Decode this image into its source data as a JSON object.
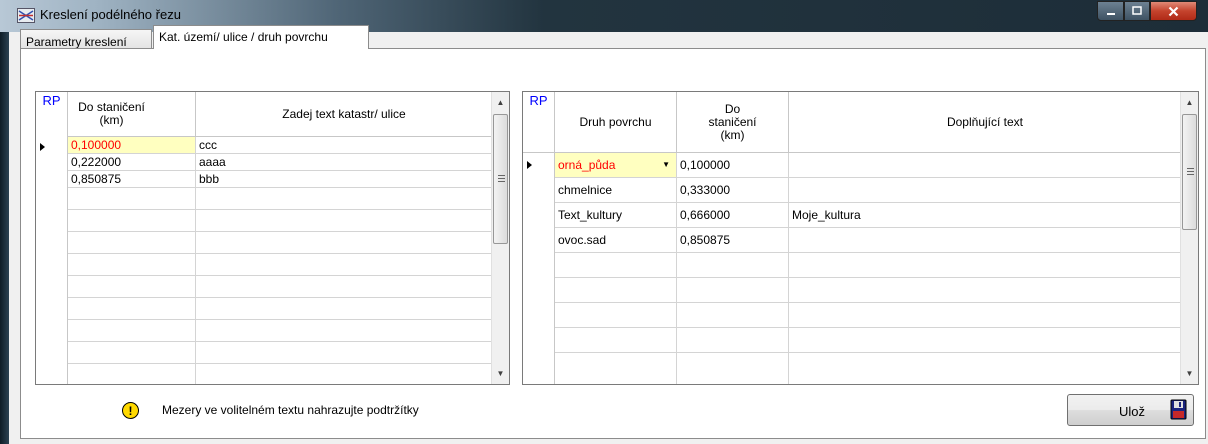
{
  "window": {
    "title": "Kreslení podélného řezu"
  },
  "tabs": [
    {
      "label": "Parametry kreslení"
    },
    {
      "label": "Kat. území/ ulice / druh povrchu"
    }
  ],
  "left_grid": {
    "rp_header": "RP",
    "col1_header": "Do staničení (km)",
    "col2_header": "Zadej text katastr/ ulice",
    "rows": [
      {
        "station": "0,100000",
        "text": "ccc"
      },
      {
        "station": "0,222000",
        "text": "aaaa"
      },
      {
        "station": "0,850875",
        "text": "bbb"
      }
    ]
  },
  "right_grid": {
    "rp_header": "RP",
    "col1_header": "Druh povrchu",
    "col2_header": "Do staničení (km)",
    "col3_header": "Doplňující text",
    "rows": [
      {
        "surface": "orná_půda",
        "station": "0,100000",
        "text": ""
      },
      {
        "surface": "chmelnice",
        "station": "0,333000",
        "text": ""
      },
      {
        "surface": "Text_kultury",
        "station": "0,666000",
        "text": "Moje_kultura"
      },
      {
        "surface": "ovoc.sad",
        "station": "0,850875",
        "text": ""
      }
    ]
  },
  "note": "Mezery ve volitelném  textu nahrazujte podtržítky",
  "save_button": {
    "label": "Ulož"
  },
  "colors": {
    "highlight_text": "#ff0000",
    "highlight_bg": "#ffffc0",
    "rp_header": "#0000ff",
    "warning": "#ffd900"
  },
  "icons": [
    "app-icon",
    "minimize-icon",
    "maximize-icon",
    "close-icon",
    "warning-icon",
    "floppy-disk-icon",
    "dropdown-arrow-icon",
    "row-indicator-icon"
  ]
}
